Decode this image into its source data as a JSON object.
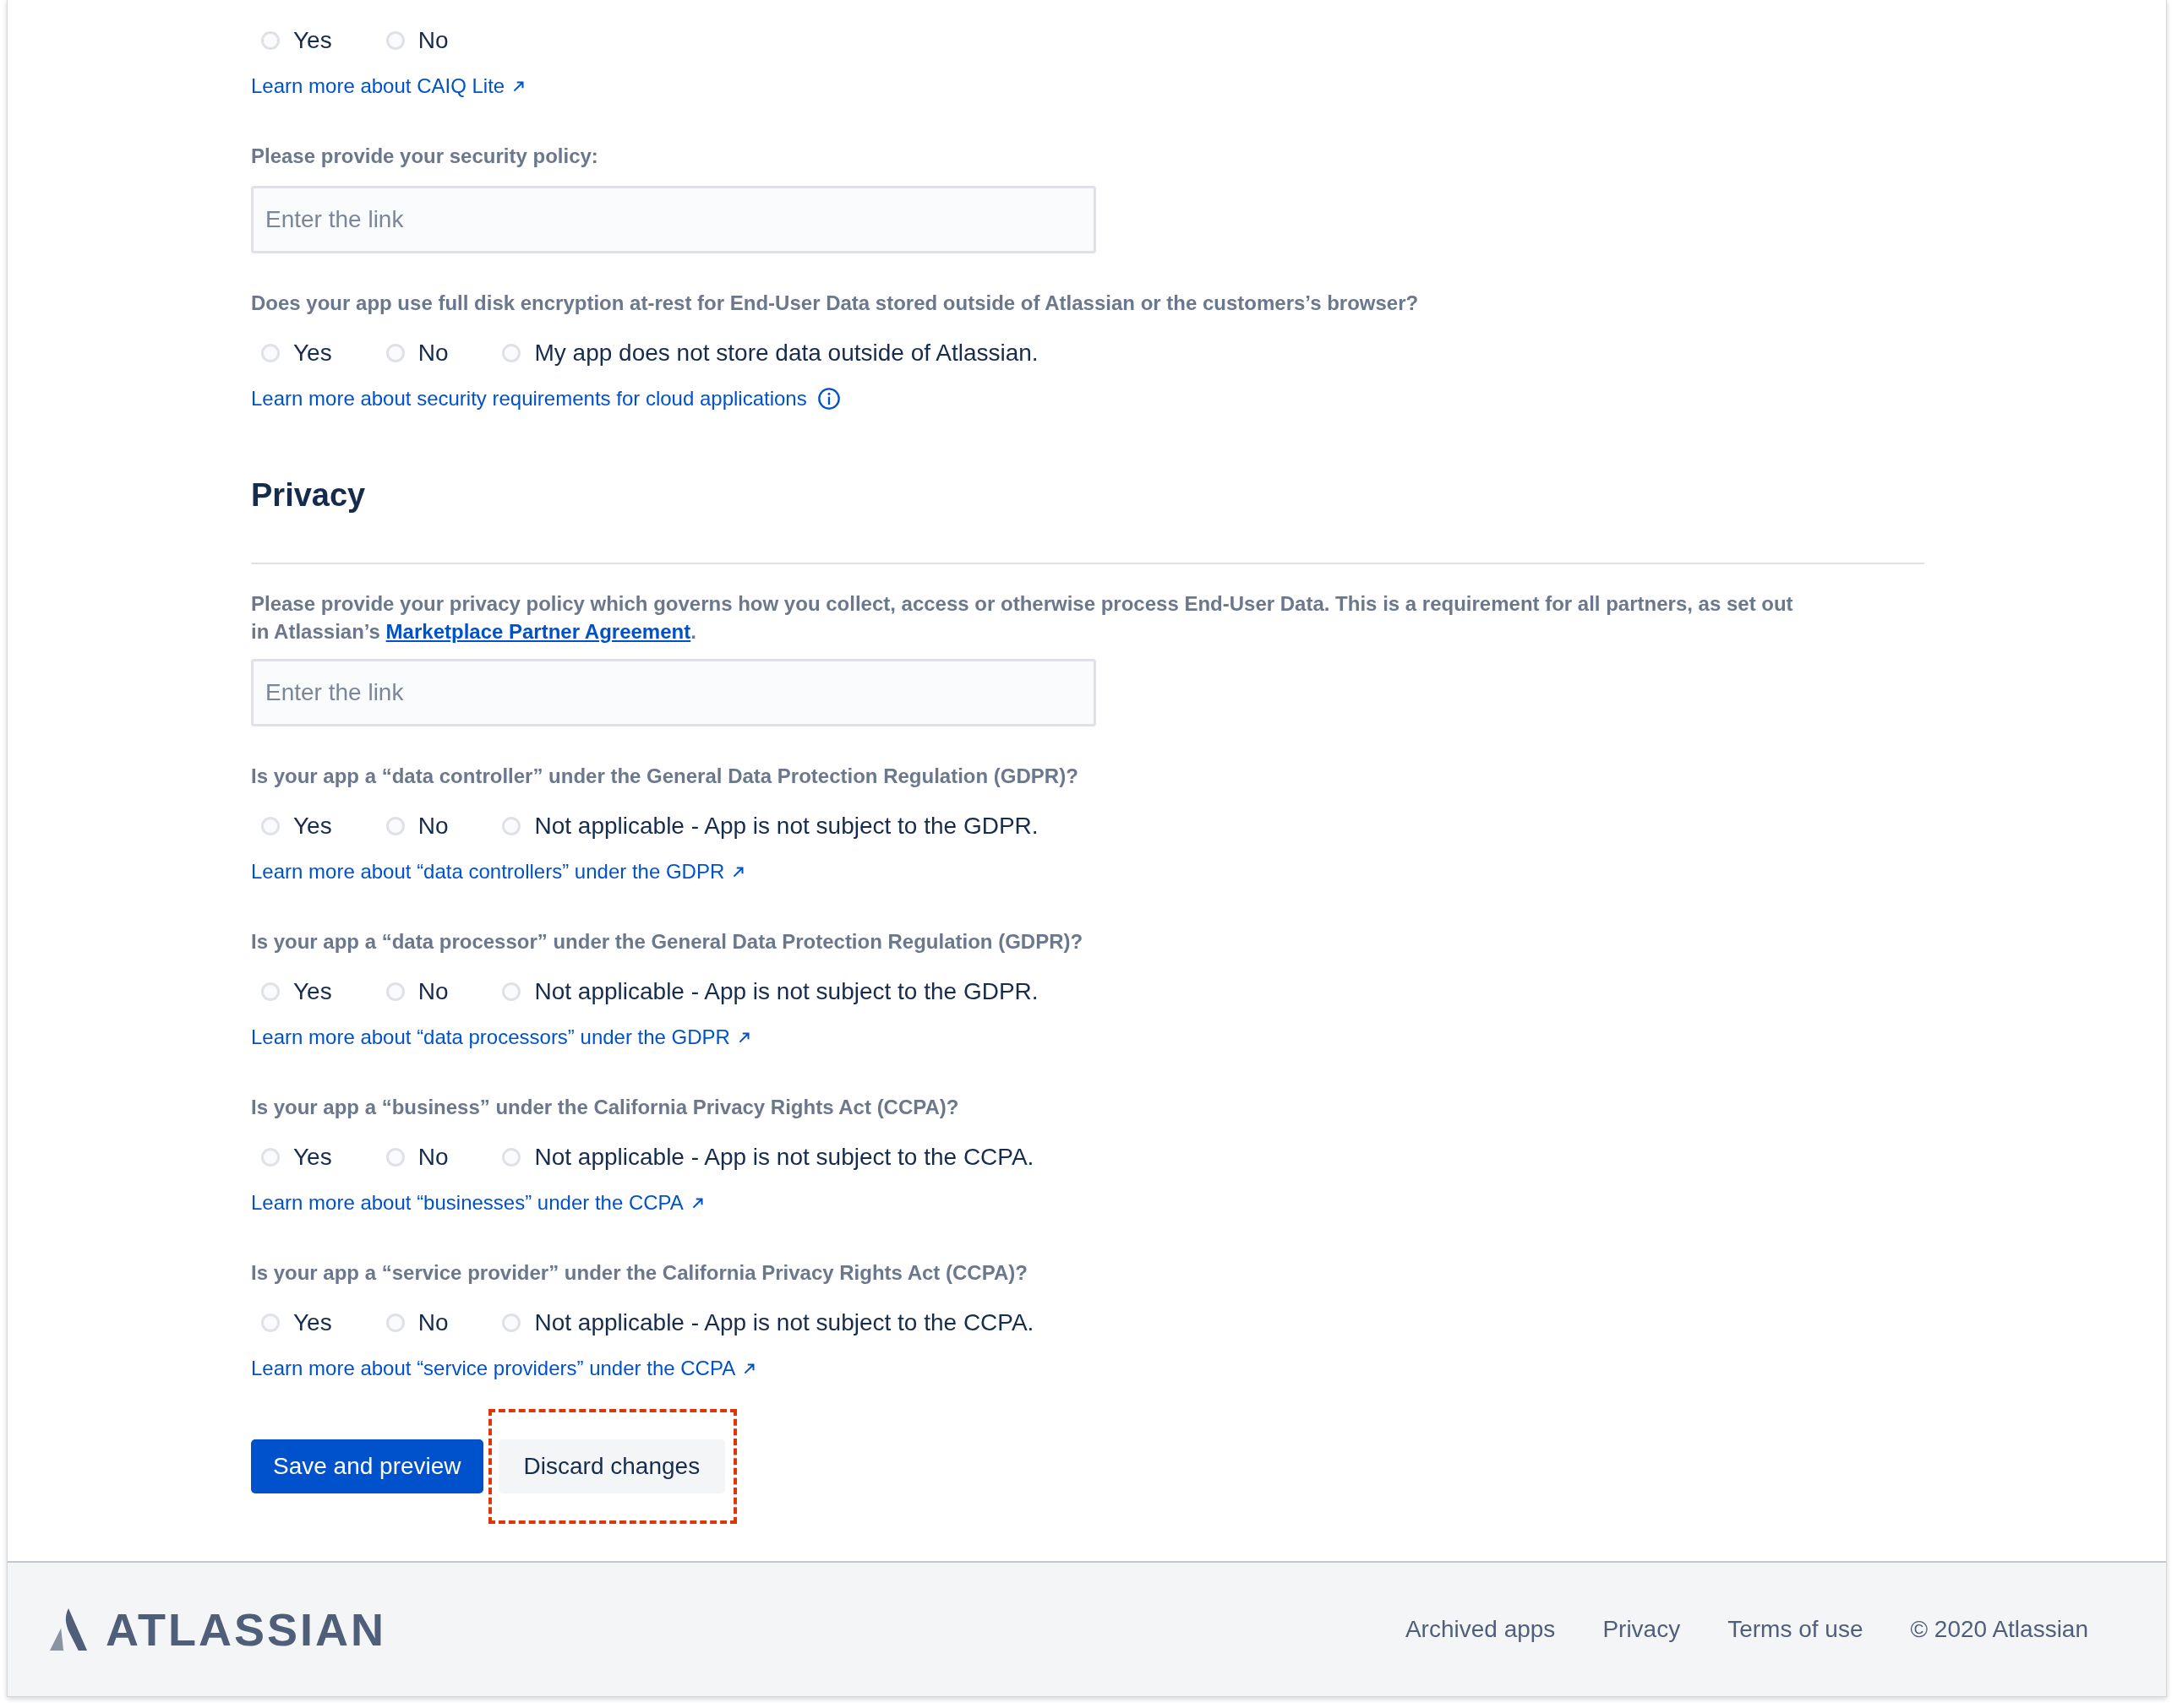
{
  "blocks": [
    {
      "kind": "radios",
      "options": [
        {
          "label": "Yes",
          "selected": false
        },
        {
          "label": "No",
          "selected": false
        }
      ]
    },
    {
      "kind": "link",
      "text": "Learn more about CAIQ Lite"
    },
    {
      "kind": "field",
      "label": "Please provide your security policy:",
      "placeholder": "Enter the link"
    },
    {
      "kind": "question",
      "text": "Does your app use full disk encryption at-rest for End-User Data stored outside of Atlassian or the customers’s browser?"
    },
    {
      "kind": "radios",
      "options": [
        {
          "label": "Yes",
          "selected": false
        },
        {
          "label": "No",
          "selected": false
        },
        {
          "label": "My app does not store data outside of Atlassian.",
          "selected": false
        }
      ]
    },
    {
      "kind": "info_link",
      "text": "Learn more about security requirements for cloud applications"
    },
    {
      "kind": "heading",
      "text": "Privacy"
    },
    {
      "kind": "paragraph",
      "text": "Please provide your privacy policy which governs how you collect, access or otherwise process End-User Data. This is a requirement for all partners, as set out in Atlassian’s ",
      "link": "Marketplace Partner Agreement",
      "after": "."
    },
    {
      "kind": "input",
      "placeholder": "Enter the link"
    },
    {
      "kind": "question",
      "text": "Is your app a “data controller” under the General Data Protection Regulation (GDPR)?"
    },
    {
      "kind": "radios",
      "options": [
        {
          "label": "Yes",
          "selected": false
        },
        {
          "label": "No",
          "selected": false
        },
        {
          "label": "Not applicable - App is not subject to the GDPR.",
          "selected": false
        }
      ]
    },
    {
      "kind": "link",
      "text": "Learn more about “data controllers” under the GDPR"
    },
    {
      "kind": "question",
      "text": "Is your app a “data processor” under the General Data Protection Regulation (GDPR)?"
    },
    {
      "kind": "radios",
      "options": [
        {
          "label": "Yes",
          "selected": false
        },
        {
          "label": "No",
          "selected": false
        },
        {
          "label": "Not applicable - App is not subject to the GDPR.",
          "selected": false
        }
      ]
    },
    {
      "kind": "link",
      "text": "Learn more about “data processors” under the GDPR"
    },
    {
      "kind": "question",
      "text": "Is your app a “business” under the California Privacy Rights Act (CCPA)?"
    },
    {
      "kind": "radios",
      "options": [
        {
          "label": "Yes",
          "selected": false
        },
        {
          "label": "No",
          "selected": false
        },
        {
          "label": "Not applicable - App is not subject to the CCPA.",
          "selected": false
        }
      ]
    },
    {
      "kind": "link",
      "text": "Learn more about “businesses” under the CCPA"
    },
    {
      "kind": "question",
      "text": "Is your app a “service provider” under the California Privacy Rights Act (CCPA)?"
    },
    {
      "kind": "radios",
      "options": [
        {
          "label": "Yes",
          "selected": false
        },
        {
          "label": "No",
          "selected": false
        },
        {
          "label": "Not applicable - App is not subject to the CCPA.",
          "selected": false
        }
      ]
    },
    {
      "kind": "link",
      "text": "Learn more about “service providers” under the CCPA"
    }
  ],
  "buttons": [
    {
      "label": "Save and preview",
      "kind": "primary",
      "highlighted": false
    },
    {
      "label": "Discard changes",
      "kind": "subtle",
      "highlighted": true
    }
  ],
  "footer": {
    "logo": "ATLASSIAN",
    "links": [
      "Archived apps",
      "Privacy",
      "Terms of use"
    ],
    "copyright": "© 2020 Atlassian"
  }
}
